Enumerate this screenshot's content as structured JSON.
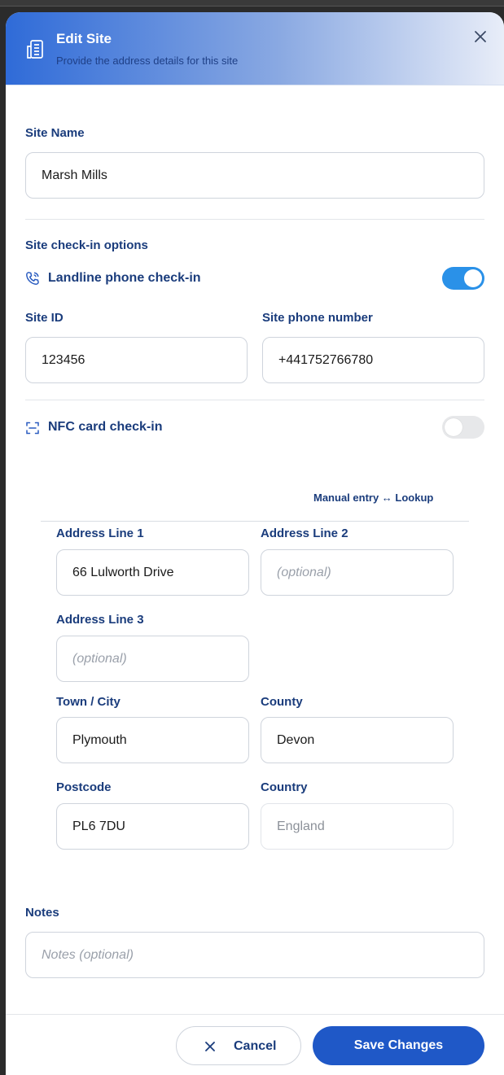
{
  "header": {
    "title": "Edit Site",
    "subtitle": "Provide the address details for this site"
  },
  "site_name": {
    "label": "Site Name",
    "value": "Marsh Mills"
  },
  "checkin": {
    "section_title": "Site check-in options",
    "landline": {
      "label": "Landline phone check-in",
      "enabled": true
    },
    "site_id": {
      "label": "Site ID",
      "value": "123456"
    },
    "site_phone": {
      "label": "Site phone number",
      "value": "+441752766780"
    },
    "nfc": {
      "label": "NFC card check-in",
      "enabled": false
    }
  },
  "address": {
    "mode_link": "Manual entry ↔ Lookup",
    "line1": {
      "label": "Address Line 1",
      "value": "66 Lulworth Drive"
    },
    "line2": {
      "label": "Address Line 2",
      "placeholder": "(optional)"
    },
    "line3": {
      "label": "Address Line 3",
      "placeholder": "(optional)"
    },
    "town": {
      "label": "Town / City",
      "value": "Plymouth"
    },
    "county": {
      "label": "County",
      "value": "Devon"
    },
    "postcode": {
      "label": "Postcode",
      "value": "PL6 7DU"
    },
    "country": {
      "label": "Country",
      "value": "England"
    }
  },
  "notes": {
    "label": "Notes",
    "placeholder": "Notes (optional)"
  },
  "footer": {
    "cancel_label": "Cancel",
    "save_label": "Save Changes"
  },
  "colors": {
    "primary": "#1f58c7",
    "label": "#1a3c7c",
    "toggle_on": "#2a91e8"
  },
  "icons": {
    "header": "building-icon",
    "close": "close-icon",
    "landline": "phone-icon",
    "nfc": "scan-icon",
    "cancel": "x-icon"
  }
}
